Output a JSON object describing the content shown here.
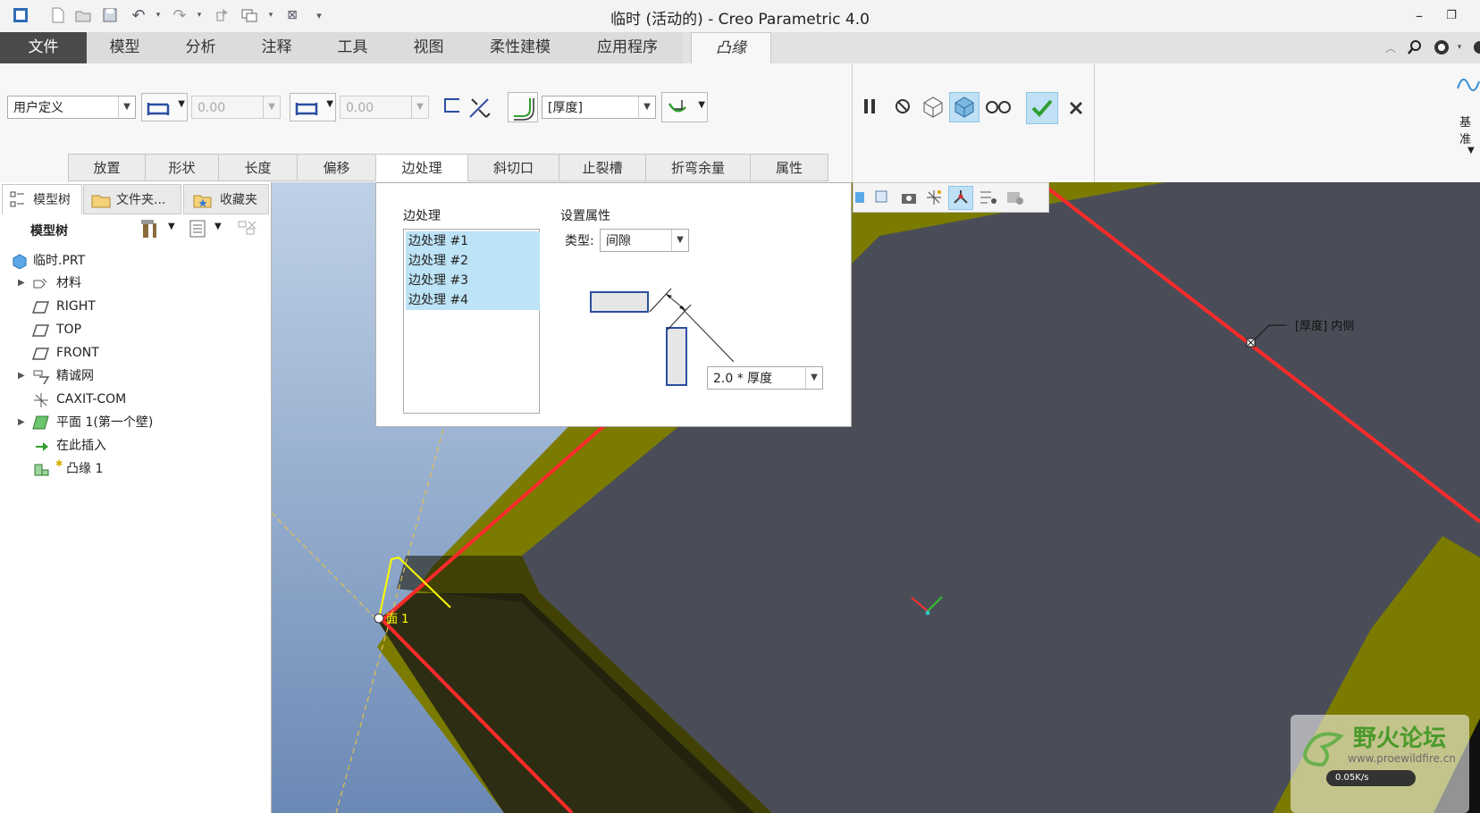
{
  "window": {
    "title": "临时 (活动的) - Creo Parametric 4.0"
  },
  "ribbon_tabs": [
    {
      "label": "文件"
    },
    {
      "label": "模型"
    },
    {
      "label": "分析"
    },
    {
      "label": "注释"
    },
    {
      "label": "工具"
    },
    {
      "label": "视图"
    },
    {
      "label": "柔性建模"
    },
    {
      "label": "应用程序"
    },
    {
      "label": "凸缘"
    }
  ],
  "toolbar": {
    "shape_combo": "用户定义",
    "value1": "0.00",
    "value2": "0.00",
    "thickness_combo": "[厚度]",
    "datum_label": "基准"
  },
  "sub_tabs": [
    {
      "label": "放置"
    },
    {
      "label": "形状"
    },
    {
      "label": "长度"
    },
    {
      "label": "偏移"
    },
    {
      "label": "边处理"
    },
    {
      "label": "斜切口"
    },
    {
      "label": "止裂槽"
    },
    {
      "label": "折弯余量"
    },
    {
      "label": "属性"
    }
  ],
  "panel_tabs": [
    {
      "label": "模型树"
    },
    {
      "label": "文件夹..."
    },
    {
      "label": "收藏夹"
    }
  ],
  "model_tree": {
    "header": "模型树",
    "items": [
      {
        "label": "临时.PRT"
      },
      {
        "label": "材料"
      },
      {
        "label": "RIGHT"
      },
      {
        "label": "TOP"
      },
      {
        "label": "FRONT"
      },
      {
        "label": "精诚网"
      },
      {
        "label": "CAXIT-COM"
      },
      {
        "label": "平面 1(第一个壁)"
      },
      {
        "label": "在此插入"
      },
      {
        "label": "凸缘 1"
      }
    ]
  },
  "edge_panel": {
    "list_title": "边处理",
    "items": [
      "边处理 #1",
      "边处理 #2",
      "边处理 #3",
      "边处理 #4"
    ],
    "props_title": "设置属性",
    "type_label": "类型:",
    "type_value": "间隙",
    "gap_value": "2.0 * 厚度"
  },
  "viewport": {
    "annotation": "[厚度] 内侧",
    "plane_label": "面 1",
    "watermark_title": "野火论坛",
    "watermark_url": "www.proewildfire.cn",
    "speed": "0.05K/s"
  },
  "colors": {
    "accent_green": "#2e9e2e",
    "highlight_blue": "#bde3f6",
    "model_olive": "#7a7b00",
    "model_face": "#4a4d57",
    "edge_red": "#ff2a2a"
  }
}
